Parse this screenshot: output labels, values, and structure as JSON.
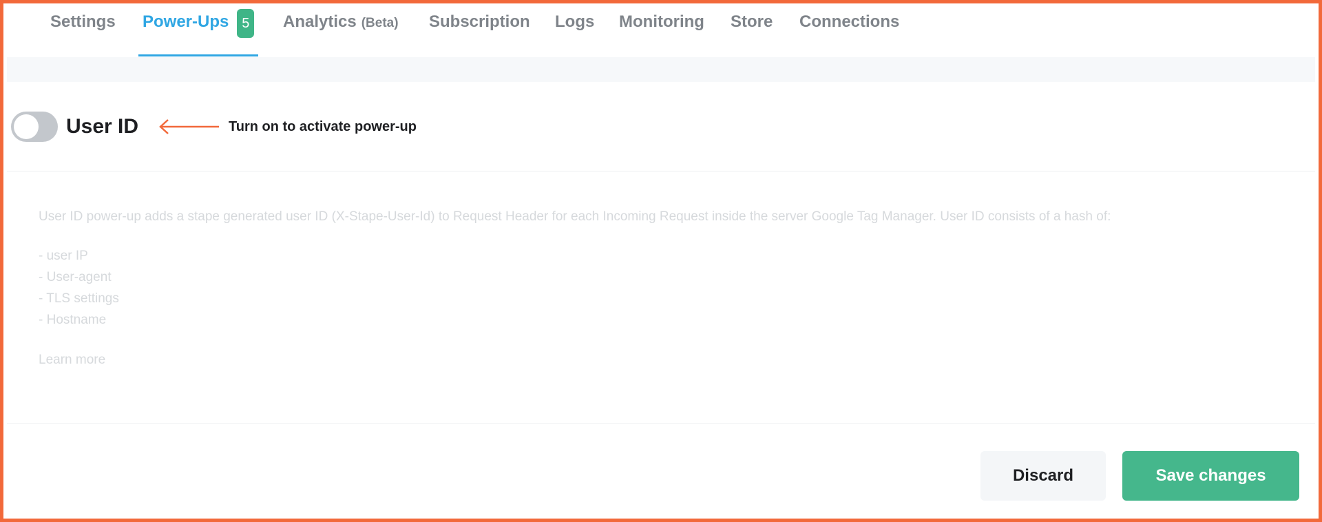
{
  "tabs": [
    {
      "label": "Settings"
    },
    {
      "label": "Power-Ups",
      "badge": "5",
      "active": true
    },
    {
      "label": "Analytics",
      "suffix": "(Beta)"
    },
    {
      "label": "Subscription"
    },
    {
      "label": "Logs"
    },
    {
      "label": "Monitoring"
    },
    {
      "label": "Store"
    },
    {
      "label": "Connections"
    }
  ],
  "powerup": {
    "enabled": false,
    "title": "User ID",
    "hint": "Turn on to activate power-up",
    "description": "User ID power-up adds a stape generated user ID (X-Stape-User-Id) to Request Header for each Incoming Request inside the server Google Tag Manager. User ID consists of a hash of:",
    "bullets": [
      "- user IP",
      "- User-agent",
      "- TLS settings",
      "- Hostname"
    ],
    "learn_more": "Learn more"
  },
  "actions": {
    "discard": "Discard",
    "save": "Save changes"
  },
  "colors": {
    "accent": "#2fa6e3",
    "badge": "#3fb587",
    "save_button": "#45b78c",
    "frame": "#f2693a",
    "arrow": "#f2693a"
  },
  "icons": {
    "hint_arrow": "arrow-left-icon"
  }
}
